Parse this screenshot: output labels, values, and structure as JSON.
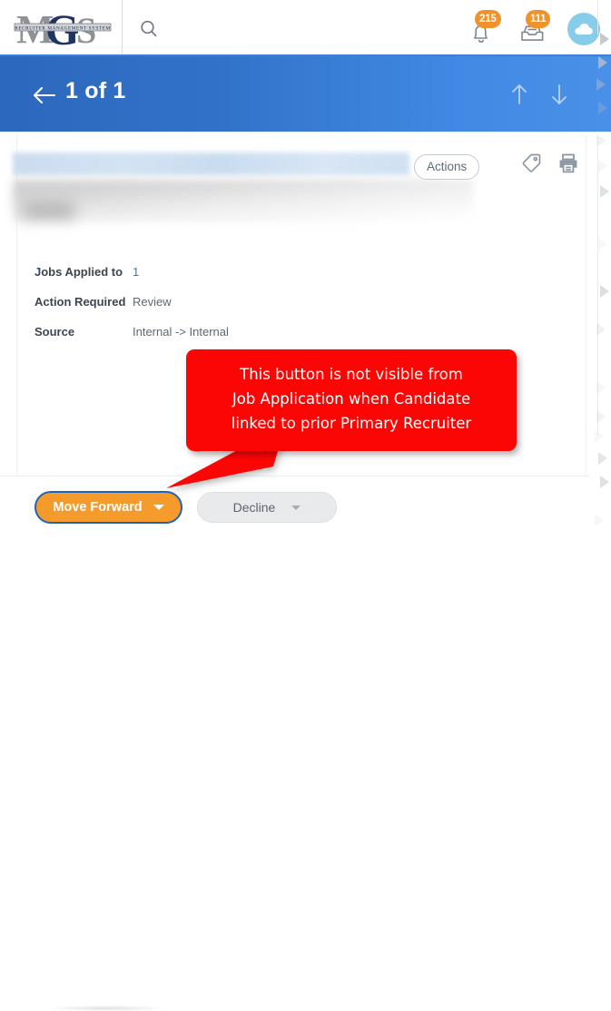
{
  "topbar": {
    "logo": {
      "letters": "MGS",
      "banner_text": "RECRUITER MANAGEMENT SYSTEM",
      "icon": "mgs-logo"
    },
    "search_icon": "search-icon",
    "notifications": {
      "icon": "bell-icon",
      "count": "215"
    },
    "inbox": {
      "icon": "inbox-tray-icon",
      "count": "111"
    },
    "avatar": {
      "icon": "cloud-icon"
    }
  },
  "subheader": {
    "back_icon": "arrow-left-icon",
    "counter": "1 of 1",
    "prev_icon": "arrow-up-icon",
    "next_icon": "arrow-down-icon"
  },
  "record": {
    "actions_label": "Actions",
    "tag_icon": "tag-icon",
    "print_icon": "printer-icon",
    "details": [
      {
        "label": "Jobs Applied to",
        "value": "1",
        "is_link": true
      },
      {
        "label": "Action Required",
        "value": "Review",
        "is_link": false
      },
      {
        "label": "Source",
        "value": "Internal -> Internal",
        "is_link": false
      }
    ]
  },
  "callout": {
    "text": "This button is not visible from\nJob Application when Candidate\nlinked to prior Primary Recruiter",
    "background": "#fb0505",
    "text_color": "#ffffff"
  },
  "footer": {
    "move_forward_label": "Move Forward",
    "move_forward_caret": "chevron-down-icon",
    "decline_label": "Decline",
    "decline_caret": "chevron-down-icon"
  },
  "colors": {
    "header_blue_dark": "#2c68bd",
    "header_blue_light": "#4a90e8",
    "badge_orange": "#f0922b",
    "button_orange": "#f59b2c",
    "focus_blue": "#1f63b8",
    "link_blue": "#2e7cc4",
    "avatar_blue": "#87cdea"
  }
}
